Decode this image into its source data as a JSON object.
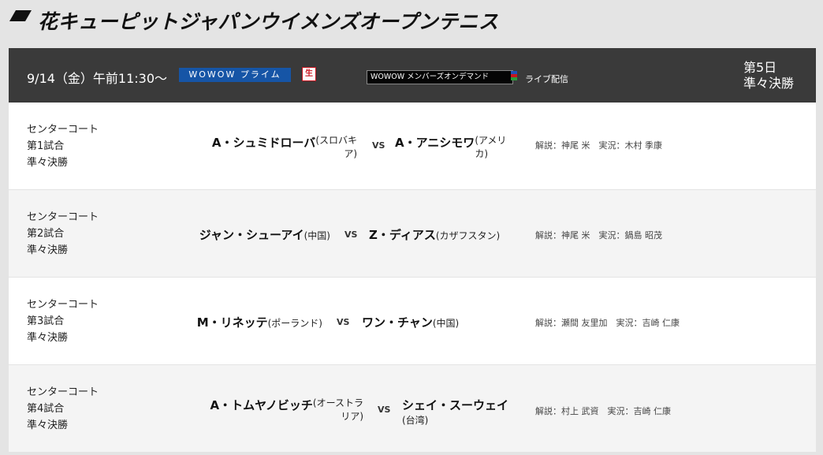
{
  "page": {
    "title": "花キューピットジャパンウイメンズオープンテニス"
  },
  "schedule": {
    "date_time": "9/14（金）午前11:30～",
    "channel": "WOWOW プライム",
    "live_mark": "生",
    "ondemand": "WOWOW メンバーズオンデマンド",
    "live_stream": "ライブ配信",
    "day": "第5日",
    "round": "準々決勝",
    "colors": {
      "header_bg": "#3a3a3a",
      "prime_badge": "#1655a6",
      "live_mark": "#c8141e",
      "stripe_colors": [
        "#1f4fb5",
        "#c8141e",
        "#2a9a3a"
      ]
    }
  },
  "matches": [
    {
      "court": "センターコート",
      "match_no": "第1試合",
      "round": "準々決勝",
      "player1": "A・シュミドローバ",
      "country1_a": "(スロバキ",
      "country1_b": "ア)",
      "vs": "VS",
      "player2": "A・アニシモワ",
      "country2_a": "(アメリ",
      "country2_b": "カ)",
      "commentary": "解説：神尾 米　実況：木村 季康"
    },
    {
      "court": "センターコート",
      "match_no": "第2試合",
      "round": "準々決勝",
      "player1": "ジャン・シューアイ",
      "country1": "(中国)",
      "vs": "VS",
      "player2": "Z・ディアス",
      "country2": "(カザフスタン)",
      "commentary": "解説：神尾 米　実況：鍋島 昭茂"
    },
    {
      "court": "センターコート",
      "match_no": "第3試合",
      "round": "準々決勝",
      "player1": "M・リネッテ",
      "country1": "(ポーランド)",
      "vs": "VS",
      "player2": "ワン・チャン",
      "country2": "(中国)",
      "commentary": "解説：瀬間 友里加　実況：吉崎 仁康"
    },
    {
      "court": "センターコート",
      "match_no": "第4試合",
      "round": "準々決勝",
      "player1": "A・トムヤノビッチ",
      "country1_a": "(オーストラ",
      "country1_b": "リア)",
      "vs": "VS",
      "player2": "シェイ・スーウェイ",
      "country2": "(台湾)",
      "commentary": "解説：村上 武資　実況：吉崎 仁康"
    }
  ]
}
